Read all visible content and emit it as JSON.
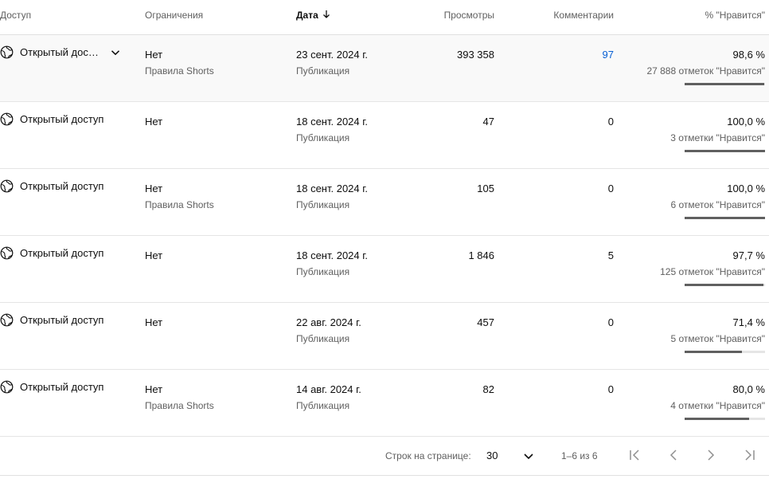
{
  "header": {
    "access": "Доступ",
    "restrictions": "Ограничения",
    "date": "Дата",
    "views": "Просмотры",
    "comments": "Комментарии",
    "likes": "% \"Нравится\""
  },
  "rows": [
    {
      "access": "Открытый дос…",
      "restriction": "Нет",
      "restriction_note": "Правила Shorts",
      "date": "23 сент. 2024 г.",
      "date_note": "Публикация",
      "views": "393 358",
      "comments": "97",
      "likes_pct": "98,6 %",
      "likes_count": "27 888 отметок \"Нравится\"",
      "likes_ratio": 0.986
    },
    {
      "access": "Открытый доступ",
      "restriction": "Нет",
      "restriction_note": "",
      "date": "18 сент. 2024 г.",
      "date_note": "Публикация",
      "views": "47",
      "comments": "0",
      "likes_pct": "100,0 %",
      "likes_count": "3 отметки \"Нравится\"",
      "likes_ratio": 1.0
    },
    {
      "access": "Открытый доступ",
      "restriction": "Нет",
      "restriction_note": "Правила Shorts",
      "date": "18 сент. 2024 г.",
      "date_note": "Публикация",
      "views": "105",
      "comments": "0",
      "likes_pct": "100,0 %",
      "likes_count": "6 отметок \"Нравится\"",
      "likes_ratio": 1.0
    },
    {
      "access": "Открытый доступ",
      "restriction": "Нет",
      "restriction_note": "",
      "date": "18 сент. 2024 г.",
      "date_note": "Публикация",
      "views": "1 846",
      "comments": "5",
      "likes_pct": "97,7 %",
      "likes_count": "125 отметок \"Нравится\"",
      "likes_ratio": 0.977
    },
    {
      "access": "Открытый доступ",
      "restriction": "Нет",
      "restriction_note": "",
      "date": "22 авг. 2024 г.",
      "date_note": "Публикация",
      "views": "457",
      "comments": "0",
      "likes_pct": "71,4 %",
      "likes_count": "5 отметок \"Нравится\"",
      "likes_ratio": 0.714
    },
    {
      "access": "Открытый доступ",
      "restriction": "Нет",
      "restriction_note": "Правила Shorts",
      "date": "14 авг. 2024 г.",
      "date_note": "Публикация",
      "views": "82",
      "comments": "0",
      "likes_pct": "80,0 %",
      "likes_count": "4 отметки \"Нравится\"",
      "likes_ratio": 0.8
    }
  ],
  "footer": {
    "rows_per_page_label": "Строк на странице:",
    "rows_per_page_value": "30",
    "range": "1–6 из 6"
  },
  "colors": {
    "link": "#065fd4",
    "bar_fill": "#606060",
    "bar_track": "#e5e5e5"
  },
  "icons": [
    "globe-icon",
    "chevron-down-icon",
    "arrow-down-icon",
    "first-page-icon",
    "prev-page-icon",
    "next-page-icon",
    "last-page-icon"
  ]
}
